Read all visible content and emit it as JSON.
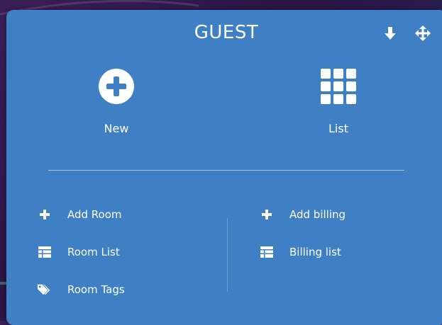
{
  "card": {
    "title": "GUEST",
    "header_icons": [
      "download-arrow-icon",
      "move-icon"
    ]
  },
  "actions": [
    {
      "label": "New",
      "icon": "plus-circle-icon"
    },
    {
      "label": "List",
      "icon": "grid-icon"
    }
  ],
  "links_left": [
    {
      "label": "Add Room",
      "icon": "plus-icon"
    },
    {
      "label": "Room List",
      "icon": "table-icon"
    },
    {
      "label": "Room Tags",
      "icon": "tags-icon"
    }
  ],
  "links_right": [
    {
      "label": "Add billing",
      "icon": "plus-icon"
    },
    {
      "label": "Billing list",
      "icon": "table-icon"
    }
  ],
  "colors": {
    "card_bg": "#3f80c4",
    "text": "#ffffff"
  }
}
